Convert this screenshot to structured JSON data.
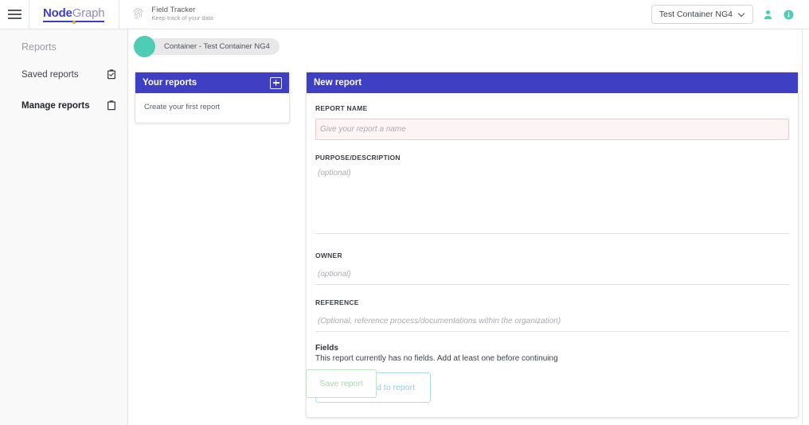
{
  "topbar": {
    "menu_icon": "hamburger-icon",
    "logo": {
      "part1": "Node",
      "part2": "Graph"
    },
    "app": {
      "icon": "fingerprint-icon",
      "title": "Field Tracker",
      "subtitle": "Keep track of your data"
    },
    "container_select": {
      "value": "Test Container NG4",
      "chevron": "chevron-down-icon"
    },
    "user_icon": "user-icon",
    "info_icon": "info-icon",
    "accent_teal": "#4ecdb6",
    "accent_indigo": "#3f3fc4"
  },
  "sidebar": {
    "title": "Reports",
    "items": [
      {
        "label": "Saved reports",
        "icon": "clipboard-check-icon",
        "active": false
      },
      {
        "label": "Manage reports",
        "icon": "clipboard-icon",
        "active": true
      }
    ]
  },
  "breadcrumb": {
    "label": "Container - Test Container NG4"
  },
  "your_reports": {
    "title": "Your reports",
    "add_icon": "plus-icon",
    "empty_text": "Create your first report"
  },
  "new_report": {
    "title": "New report",
    "report_name": {
      "label": "REPORT NAME",
      "value": "",
      "placeholder": "Give your report a name",
      "error": true
    },
    "purpose": {
      "label": "PURPOSE/DESCRIPTION",
      "value": "",
      "placeholder": "(optional)"
    },
    "owner": {
      "label": "OWNER",
      "value": "",
      "placeholder": "(optional)"
    },
    "reference": {
      "label": "REFERENCE",
      "value": "",
      "placeholder": "(Optional, reference process/documentations within the organization)"
    },
    "fields": {
      "title": "Fields",
      "description": "This report currently has no fields. Add at least one before continuing",
      "add_button": "Add new field to report"
    }
  },
  "save_button": "Save report"
}
